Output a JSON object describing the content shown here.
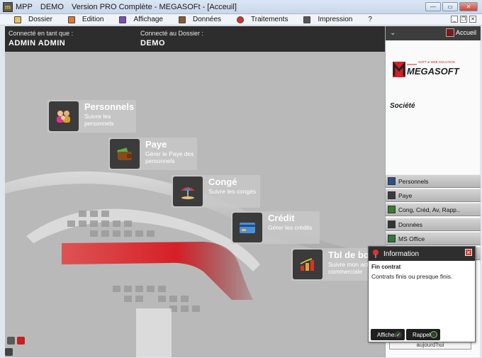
{
  "window": {
    "title_parts": [
      "MPP",
      "DEMO",
      "Version PRO Complète - MEGASOFt - [Acceuil]"
    ],
    "app_icon": "mpp-logo-icon"
  },
  "menu": [
    {
      "label": "Dossier",
      "icon": "folder-icon",
      "color": "#e8c060"
    },
    {
      "label": "Edition",
      "icon": "edit-icon",
      "color": "#e07a30"
    },
    {
      "label": "Affichage",
      "icon": "grid-view-icon",
      "color": "#7b4fb8"
    },
    {
      "label": "Données",
      "icon": "database-icon",
      "color": "#8a5a2a"
    },
    {
      "label": "Traitements",
      "icon": "process-icon",
      "color": "#d83030"
    },
    {
      "label": "Impression",
      "icon": "printer-icon",
      "color": "#555555"
    },
    {
      "label": "?",
      "icon": "",
      "color": ""
    }
  ],
  "info": {
    "user_label": "Connecté en tant que :",
    "user_value": "ADMIN ADMIN",
    "folder_label": "Connecté au Dossier :",
    "folder_value": "DEMO"
  },
  "tiles": [
    {
      "title": "Personnels",
      "sub": "Suivre les personnels",
      "icon": "people-icon"
    },
    {
      "title": "Paye",
      "sub": "Gérer le Paye des personnels",
      "icon": "wallet-icon"
    },
    {
      "title": "Congé",
      "sub": "Suivre les congés",
      "icon": "beach-umbrella-icon"
    },
    {
      "title": "Crédit",
      "sub": "Gérer les crédits",
      "icon": "credit-card-icon"
    },
    {
      "title": "Tbl de bo",
      "sub": "Suivre mon activité commerciale",
      "icon": "bar-chart-icon"
    }
  ],
  "right_panel": {
    "home_label": "Accueil",
    "logo_text": "MEGASOFT",
    "logo_tagline": "SOFT & WEB SOLUTION",
    "societe_label": "Société",
    "items": [
      {
        "label": "Personnels",
        "icon": "people-small-icon",
        "color": "#2d4f8a"
      },
      {
        "label": "Paye",
        "icon": "wallet-small-icon",
        "color": "#3a3a3a"
      },
      {
        "label": "Cong, Créd, Av, Rapp..",
        "icon": "calendar-small-icon",
        "color": "#3d7a2e"
      },
      {
        "label": "Données",
        "icon": "database-small-icon",
        "color": "#333333"
      },
      {
        "label": "MS Office",
        "icon": "excel-small-icon",
        "color": "#2f7a3a"
      }
    ]
  },
  "popup": {
    "title": "Information",
    "subtitle": "Fin contrat",
    "message": "Contrats finis ou presque finis.",
    "btn_afficher": "Afficher",
    "btn_rappel": "Rappel",
    "under_text": "aujourd'hui"
  },
  "colors": {
    "accent_red": "#d61f26",
    "dark_bar": "#2d2d2d"
  }
}
